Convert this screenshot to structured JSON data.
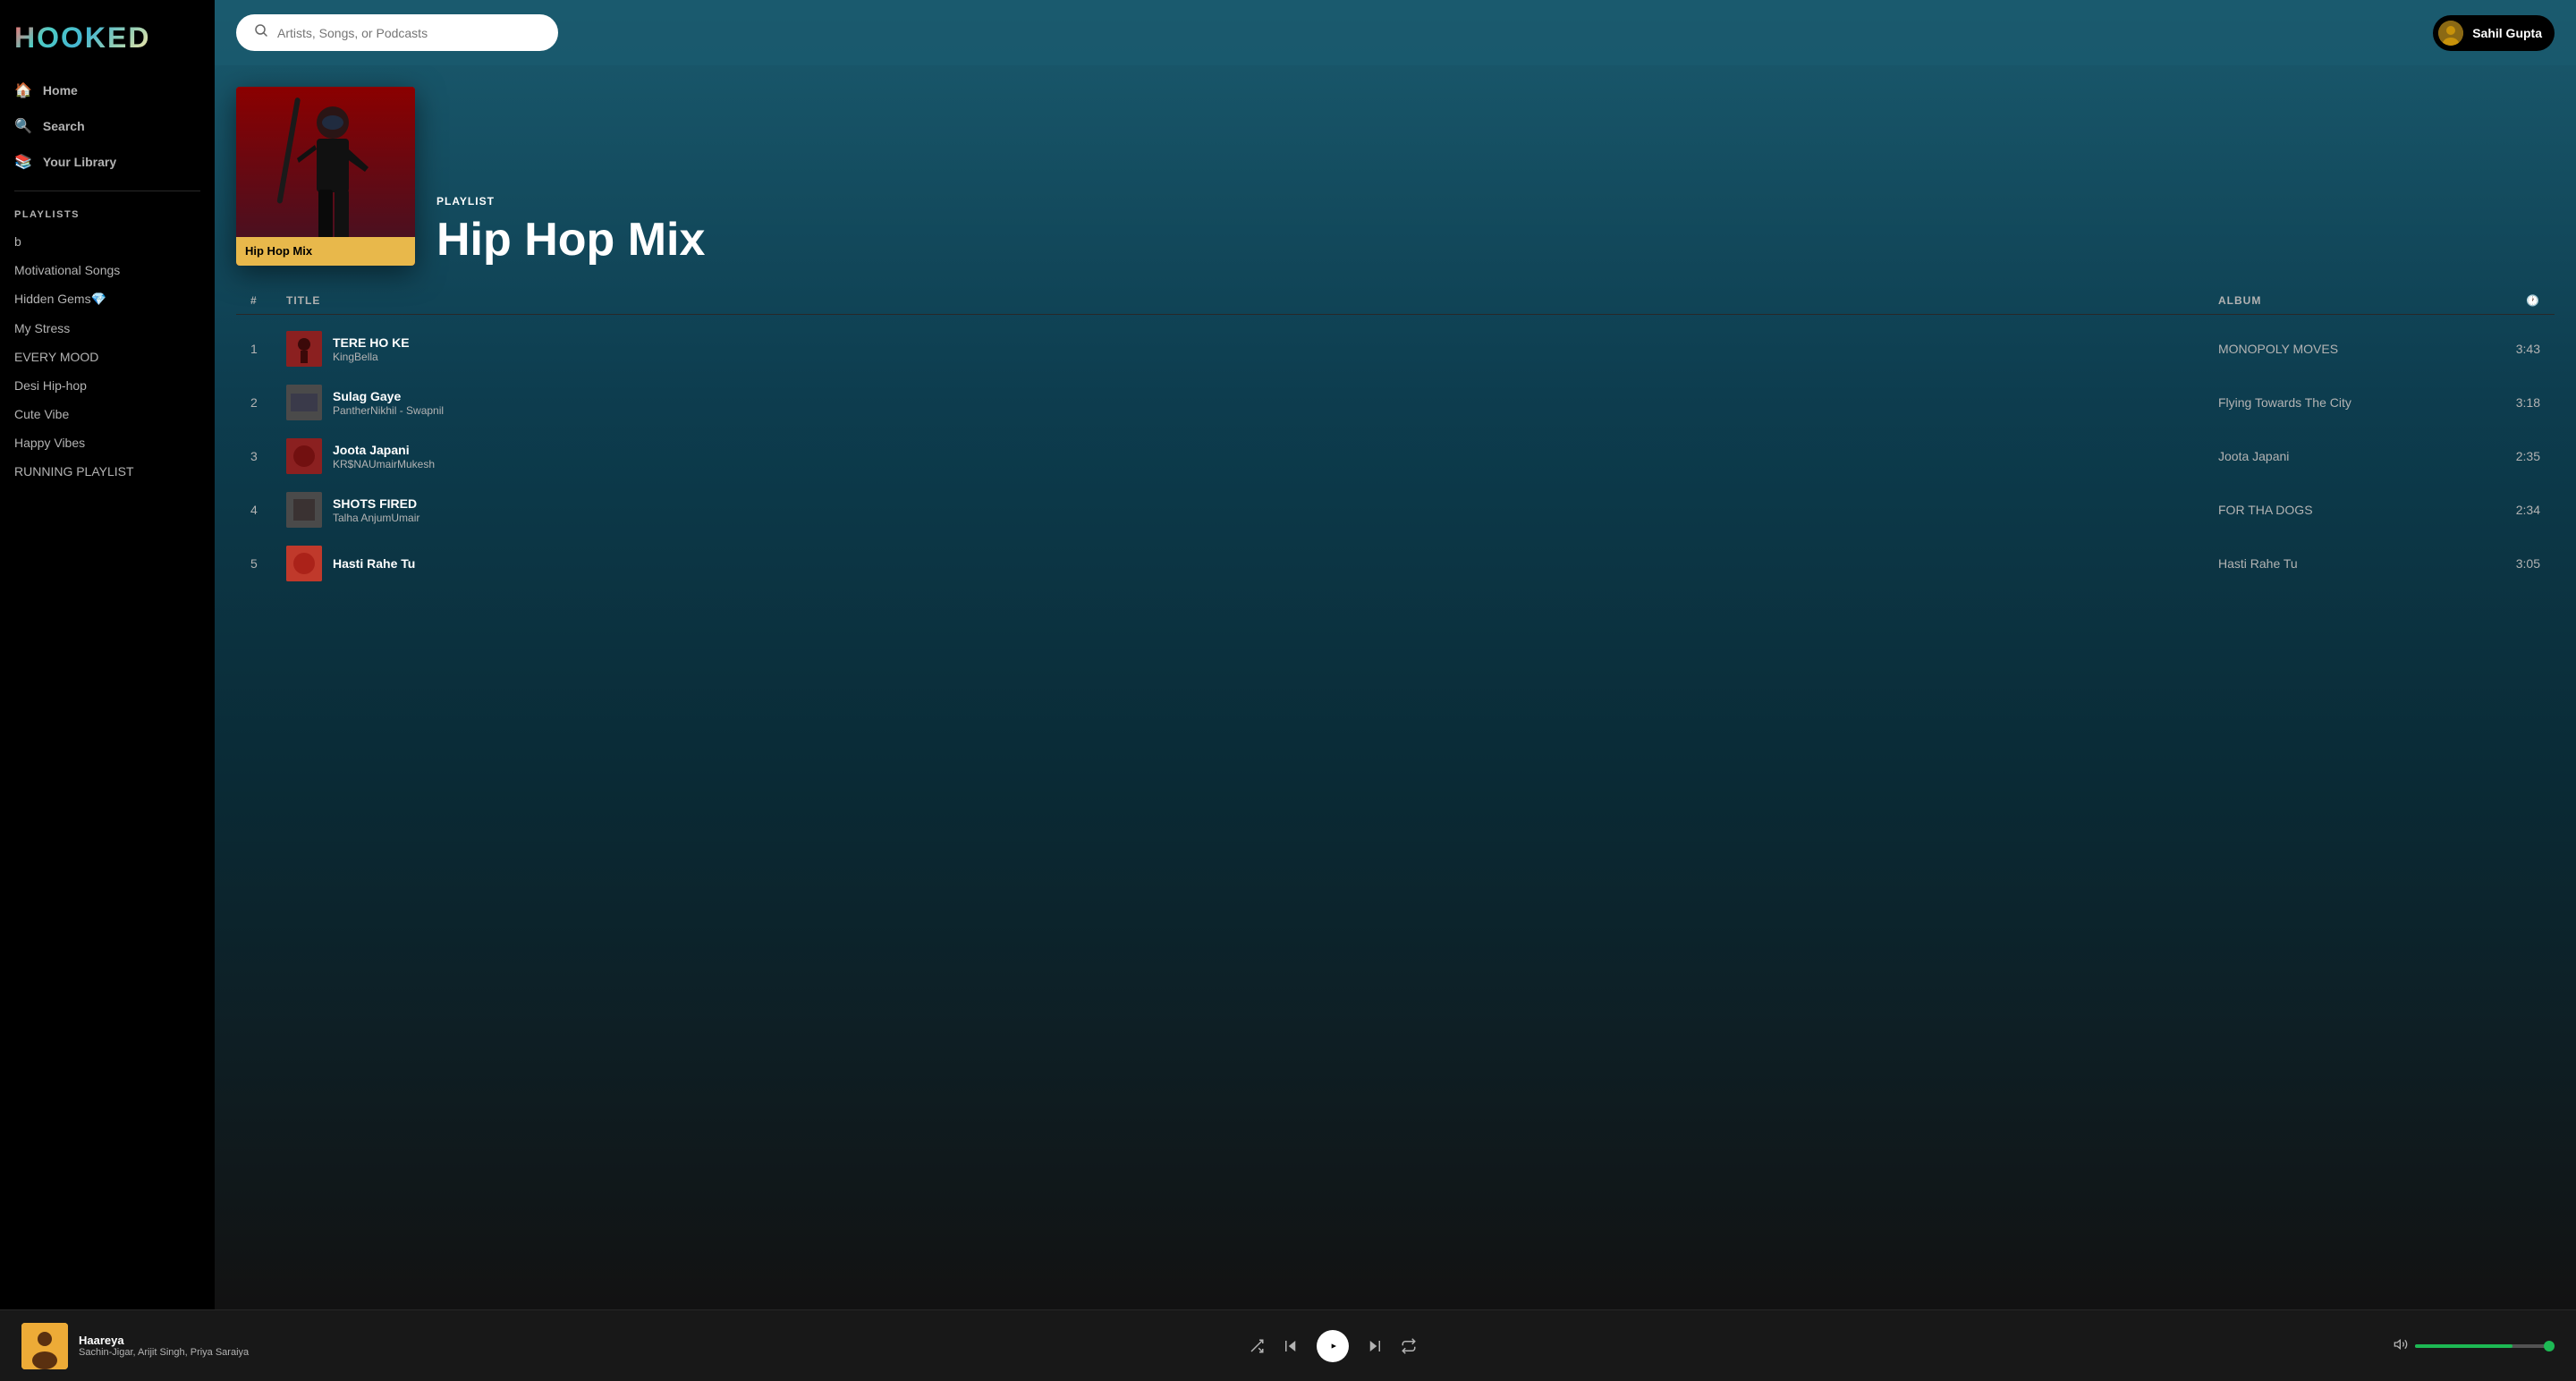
{
  "app": {
    "logo": "HOOKED"
  },
  "nav": {
    "home": "Home",
    "search": "Search",
    "library": "Your Library"
  },
  "sidebar": {
    "playlists_label": "PLAYLISTS",
    "items": [
      {
        "label": "b"
      },
      {
        "label": "Motivational Songs"
      },
      {
        "label": "Hidden Gems💎"
      },
      {
        "label": "My Stress"
      },
      {
        "label": "EVERY MOOD"
      },
      {
        "label": "Desi Hip-hop"
      },
      {
        "label": "Cute Vibe"
      },
      {
        "label": "Happy Vibes"
      },
      {
        "label": "RUNNING PLAYLIST"
      }
    ]
  },
  "search": {
    "placeholder": "Artists, Songs, or Podcasts"
  },
  "user": {
    "name": "Sahil Gupta"
  },
  "playlist": {
    "type": "PLAYLIST",
    "title": "Hip Hop Mix",
    "cover_label": "Hip Hop Mix"
  },
  "track_list": {
    "headers": {
      "num": "#",
      "title": "TITLE",
      "album": "ALBUM",
      "duration_icon": "🕐"
    },
    "tracks": [
      {
        "num": "1",
        "title": "TERE HO KE",
        "artist": "KingBella",
        "album": "MONOPOLY MOVES",
        "duration": "3:43",
        "thumb_color": "#8B2020"
      },
      {
        "num": "2",
        "title": "Sulag Gaye",
        "artist": "PantherNikhil - Swapnil",
        "album": "Flying Towards The City",
        "duration": "3:18",
        "thumb_color": "#4a4a4a"
      },
      {
        "num": "3",
        "title": "Joota Japani",
        "artist": "KR$NAUmairMukesh",
        "album": "Joota Japani",
        "duration": "2:35",
        "thumb_color": "#8B2020"
      },
      {
        "num": "4",
        "title": "SHOTS FIRED",
        "artist": "Talha AnjumUmair",
        "album": "FOR THA DOGS",
        "duration": "2:34",
        "thumb_color": "#4a4a4a"
      },
      {
        "num": "5",
        "title": "Hasti Rahe Tu",
        "artist": "",
        "album": "Hasti Rahe Tu",
        "duration": "3:05",
        "thumb_color": "#c0392b"
      }
    ]
  },
  "player": {
    "track_title": "Haareya",
    "track_artist": "Sachin-Jigar, Arijit Singh, Priya Saraiya",
    "volume_percent": 70
  }
}
